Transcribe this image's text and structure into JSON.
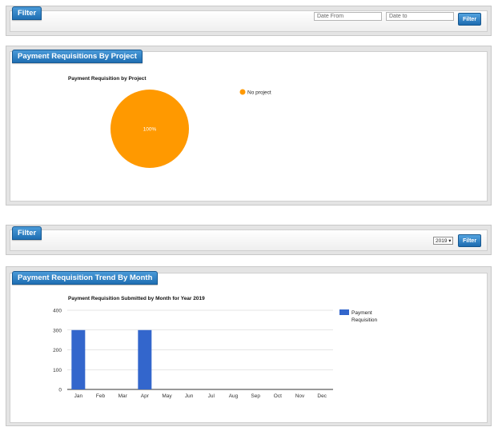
{
  "filter_top": {
    "tab_label": "Filter",
    "date_from_placeholder": "Date From",
    "date_to_placeholder": "Date to",
    "button_label": "Filter"
  },
  "project_panel": {
    "tab_label": "Payment Requisitions By Project"
  },
  "filter_bottom": {
    "tab_label": "Filter",
    "year_value": "2019",
    "year_caret": "▾",
    "button_label": "Filter"
  },
  "trend_panel": {
    "tab_label": "Payment Requisition Trend By Month"
  },
  "colors": {
    "pie": "#ff9900",
    "bar": "#3366cc",
    "accent": "#2a7fc3"
  },
  "chart_data": [
    {
      "type": "pie",
      "title": "Payment Requisition by Project",
      "slices": [
        {
          "label": "No project",
          "value": 100,
          "display": "100%"
        }
      ],
      "legend": "right"
    },
    {
      "type": "bar",
      "title": "Payment Requisition Submitted by Month for Year 2019",
      "categories": [
        "Jan",
        "Feb",
        "Mar",
        "Apr",
        "May",
        "Jun",
        "Jul",
        "Aug",
        "Sep",
        "Oct",
        "Nov",
        "Dec"
      ],
      "series": [
        {
          "name": "Payment Requisition",
          "values": [
            300,
            0,
            0,
            300,
            0,
            0,
            0,
            0,
            0,
            0,
            0,
            0
          ]
        }
      ],
      "yticks": [
        "0",
        "100",
        "200",
        "300",
        "400"
      ],
      "ylim": [
        0,
        400
      ],
      "grid": true,
      "legend": "right"
    }
  ]
}
